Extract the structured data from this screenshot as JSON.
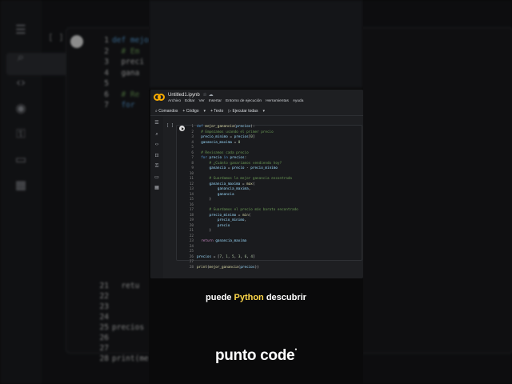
{
  "background": {
    "cell_bracket": "[ ]",
    "sidebar_icons": [
      "list-icon",
      "search-icon",
      "code-icon",
      "eye-icon",
      "key-icon",
      "folder-icon",
      "table-icon"
    ],
    "lines": [
      {
        "n": "1",
        "text": "def mejor"
      },
      {
        "n": "2",
        "text": "  # Em"
      },
      {
        "n": "3",
        "text": "  preci"
      },
      {
        "n": "4",
        "text": "  gana"
      },
      {
        "n": "5",
        "text": ""
      },
      {
        "n": "6",
        "text": "  # Re"
      },
      {
        "n": "7",
        "text": "  for"
      }
    ],
    "lower_lines": [
      {
        "n": "21",
        "text": "  retu"
      },
      {
        "n": "22",
        "text": ""
      },
      {
        "n": "23",
        "text": ""
      },
      {
        "n": "24",
        "text": ""
      },
      {
        "n": "25",
        "text": "precios"
      },
      {
        "n": "26",
        "text": ""
      },
      {
        "n": "27",
        "text": ""
      },
      {
        "n": "28",
        "text": "print(me"
      }
    ]
  },
  "colab": {
    "title": "Untitled1.ipynb",
    "title_icons": "☆ ☁",
    "menu": [
      "Archivo",
      "Editar",
      "Ver",
      "Insertar",
      "Entorno de ejecución",
      "Herramientas",
      "Ayuda"
    ],
    "toolbar": {
      "commands": "Comandos",
      "code": "+ Código",
      "text": "+ Texto",
      "run_all": "Ejecutar todas"
    },
    "cell_bracket": "[ ]"
  },
  "caption": {
    "before": "puede ",
    "highlight": "Python",
    "after": " descubrir"
  },
  "brand": "punto code"
}
